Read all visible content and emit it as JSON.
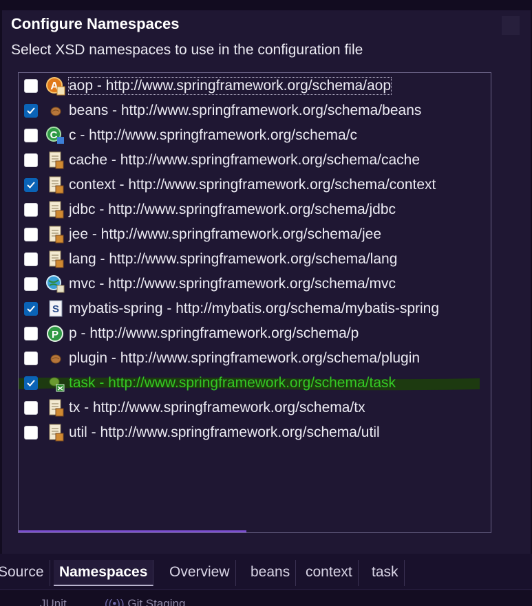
{
  "dialog": {
    "title": "Configure Namespaces",
    "subtitle": "Select XSD namespaces to use in the configuration file"
  },
  "namespaces": [
    {
      "label": "aop - http://www.springframework.org/schema/aop",
      "checked": false,
      "icon": "aop-icon"
    },
    {
      "label": "beans - http://www.springframework.org/schema/beans",
      "checked": true,
      "icon": "bean-icon"
    },
    {
      "label": "c - http://www.springframework.org/schema/c",
      "checked": false,
      "icon": "c-namespace-icon"
    },
    {
      "label": "cache - http://www.springframework.org/schema/cache",
      "checked": false,
      "icon": "xml-doc-icon"
    },
    {
      "label": "context - http://www.springframework.org/schema/context",
      "checked": true,
      "icon": "xml-doc-icon"
    },
    {
      "label": "jdbc - http://www.springframework.org/schema/jdbc",
      "checked": false,
      "icon": "xml-doc-icon"
    },
    {
      "label": "jee - http://www.springframework.org/schema/jee",
      "checked": false,
      "icon": "xml-doc-icon"
    },
    {
      "label": "lang - http://www.springframework.org/schema/lang",
      "checked": false,
      "icon": "xml-doc-icon"
    },
    {
      "label": "mvc - http://www.springframework.org/schema/mvc",
      "checked": false,
      "icon": "globe-icon"
    },
    {
      "label": "mybatis-spring - http://mybatis.org/schema/mybatis-spring",
      "checked": true,
      "icon": "s-doc-icon"
    },
    {
      "label": "p - http://www.springframework.org/schema/p",
      "checked": false,
      "icon": "p-namespace-icon"
    },
    {
      "label": "plugin - http://www.springframework.org/schema/plugin",
      "checked": false,
      "icon": "bean-icon"
    },
    {
      "label": "task - http://www.springframework.org/schema/task",
      "checked": true,
      "icon": "task-icon"
    },
    {
      "label": "tx - http://www.springframework.org/schema/tx",
      "checked": false,
      "icon": "xml-doc-icon"
    },
    {
      "label": "util - http://www.springframework.org/schema/util",
      "checked": false,
      "icon": "xml-doc-icon"
    }
  ],
  "tabs": [
    {
      "label": "Source"
    },
    {
      "label": "Namespaces",
      "active": true
    },
    {
      "label": "Overview"
    },
    {
      "label": "beans"
    },
    {
      "label": "context"
    },
    {
      "label": "task"
    }
  ],
  "bottom": {
    "item1": "JUnit",
    "item2": "Git Staging"
  },
  "colors": {
    "checkbox_checked": "#0a63b6",
    "highlight_text": "#34c825",
    "panel_bg": "#1f1733",
    "scroll_accent": "#7b4fd0"
  }
}
